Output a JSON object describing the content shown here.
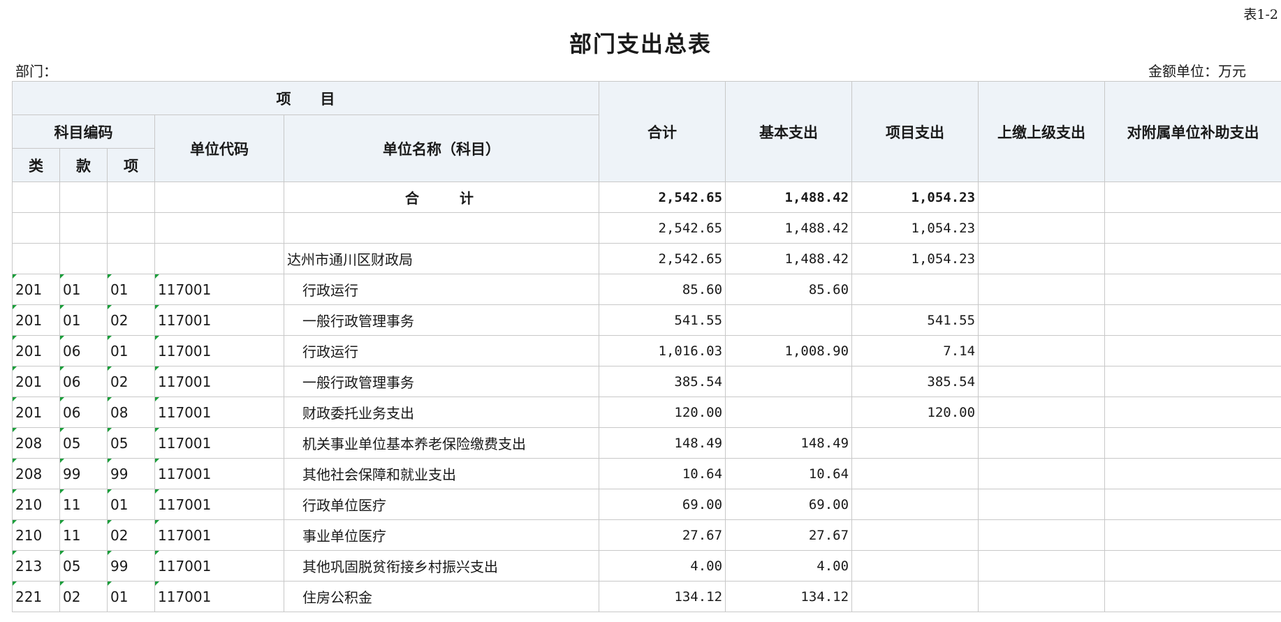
{
  "header": {
    "table_no": "表1-2",
    "title": "部门支出总表",
    "dept_label": "部门：",
    "unit_label": "金额单位：万元"
  },
  "columns": {
    "project": "项　　目",
    "subject_code": "科目编码",
    "lei": "类",
    "kuan": "款",
    "xiang": "项",
    "unit_code": "单位代码",
    "unit_name": "单位名称（科目）",
    "total": "合计",
    "basic": "基本支出",
    "project_exp": "项目支出",
    "upper": "上缴上级支出",
    "subsidy": "对附属单位补助支出"
  },
  "rows": [
    {
      "lei": "",
      "kuan": "",
      "xiang": "",
      "unit": "",
      "name": "合　　计",
      "total": "2,542.65",
      "basic": "1,488.42",
      "proj": "1,054.23",
      "upper": "",
      "subsidy": ""
    },
    {
      "lei": "",
      "kuan": "",
      "xiang": "",
      "unit": "",
      "name": "",
      "total": "2,542.65",
      "basic": "1,488.42",
      "proj": "1,054.23",
      "upper": "",
      "subsidy": ""
    },
    {
      "lei": "",
      "kuan": "",
      "xiang": "",
      "unit": "",
      "name": "达州市通川区财政局",
      "total": "2,542.65",
      "basic": "1,488.42",
      "proj": "1,054.23",
      "upper": "",
      "subsidy": ""
    },
    {
      "lei": "201",
      "kuan": "01",
      "xiang": "01",
      "unit": "117001",
      "name": "行政运行",
      "total": "85.60",
      "basic": "85.60",
      "proj": "",
      "upper": "",
      "subsidy": ""
    },
    {
      "lei": "201",
      "kuan": "01",
      "xiang": "02",
      "unit": "117001",
      "name": "一般行政管理事务",
      "total": "541.55",
      "basic": "",
      "proj": "541.55",
      "upper": "",
      "subsidy": ""
    },
    {
      "lei": "201",
      "kuan": "06",
      "xiang": "01",
      "unit": "117001",
      "name": "行政运行",
      "total": "1,016.03",
      "basic": "1,008.90",
      "proj": "7.14",
      "upper": "",
      "subsidy": ""
    },
    {
      "lei": "201",
      "kuan": "06",
      "xiang": "02",
      "unit": "117001",
      "name": "一般行政管理事务",
      "total": "385.54",
      "basic": "",
      "proj": "385.54",
      "upper": "",
      "subsidy": ""
    },
    {
      "lei": "201",
      "kuan": "06",
      "xiang": "08",
      "unit": "117001",
      "name": "财政委托业务支出",
      "total": "120.00",
      "basic": "",
      "proj": "120.00",
      "upper": "",
      "subsidy": ""
    },
    {
      "lei": "208",
      "kuan": "05",
      "xiang": "05",
      "unit": "117001",
      "name": "机关事业单位基本养老保险缴费支出",
      "total": "148.49",
      "basic": "148.49",
      "proj": "",
      "upper": "",
      "subsidy": ""
    },
    {
      "lei": "208",
      "kuan": "99",
      "xiang": "99",
      "unit": "117001",
      "name": "其他社会保障和就业支出",
      "total": "10.64",
      "basic": "10.64",
      "proj": "",
      "upper": "",
      "subsidy": ""
    },
    {
      "lei": "210",
      "kuan": "11",
      "xiang": "01",
      "unit": "117001",
      "name": "行政单位医疗",
      "total": "69.00",
      "basic": "69.00",
      "proj": "",
      "upper": "",
      "subsidy": ""
    },
    {
      "lei": "210",
      "kuan": "11",
      "xiang": "02",
      "unit": "117001",
      "name": "事业单位医疗",
      "total": "27.67",
      "basic": "27.67",
      "proj": "",
      "upper": "",
      "subsidy": ""
    },
    {
      "lei": "213",
      "kuan": "05",
      "xiang": "99",
      "unit": "117001",
      "name": "其他巩固脱贫衔接乡村振兴支出",
      "total": "4.00",
      "basic": "4.00",
      "proj": "",
      "upper": "",
      "subsidy": ""
    },
    {
      "lei": "221",
      "kuan": "02",
      "xiang": "01",
      "unit": "117001",
      "name": "住房公积金",
      "total": "134.12",
      "basic": "134.12",
      "proj": "",
      "upper": "",
      "subsidy": ""
    }
  ]
}
